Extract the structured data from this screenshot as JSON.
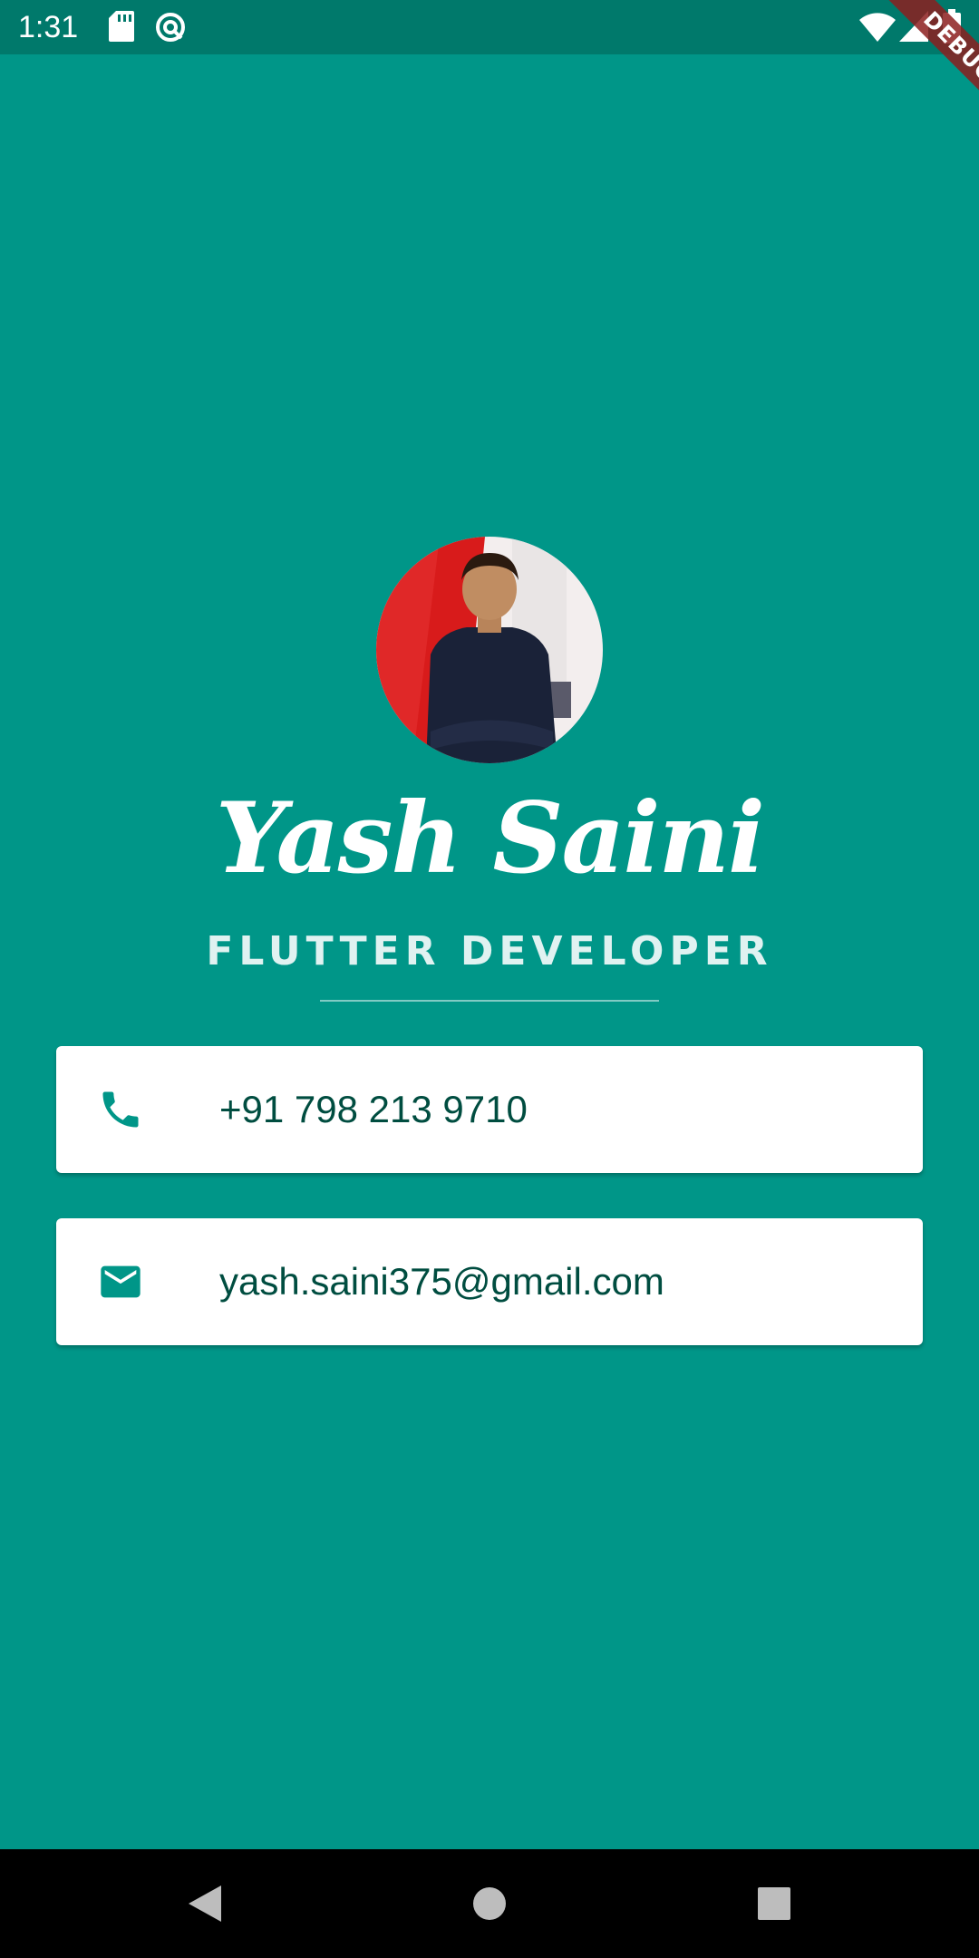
{
  "status_bar": {
    "time": "1:31",
    "icons": [
      "sd-card-icon",
      "sync-icon",
      "wifi-icon",
      "signal-icon",
      "battery-icon"
    ]
  },
  "debug_banner": "DEBUG",
  "profile": {
    "name": "Yash Saini",
    "title": "FLUTTER DEVELOPER"
  },
  "contacts": {
    "phone": {
      "icon": "phone-icon",
      "text": "+91 798 213 9710"
    },
    "email": {
      "icon": "mail-icon",
      "text": "yash.saini375@gmail.com"
    }
  },
  "colors": {
    "background": "#009688",
    "status_bar": "#00796b",
    "icon_accent": "#009688",
    "card_text": "#004d40",
    "card_background": "#ffffff"
  },
  "nav_bar": [
    "back-icon",
    "home-icon",
    "recents-icon"
  ]
}
